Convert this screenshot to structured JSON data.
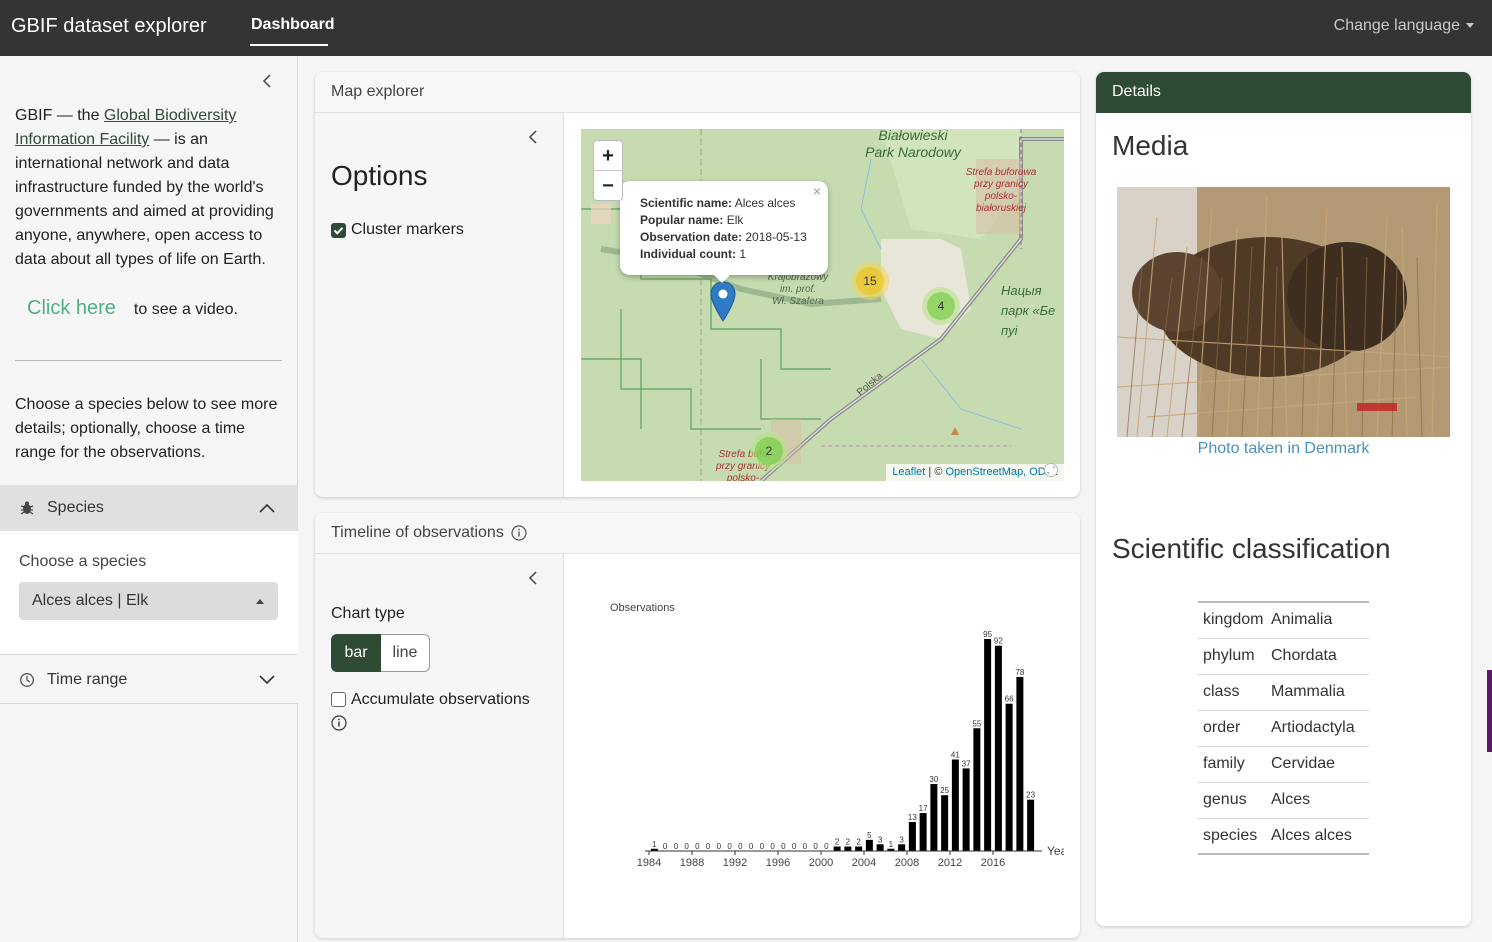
{
  "navbar": {
    "brand": "GBIF dataset explorer",
    "tab": "Dashboard",
    "language": "Change language"
  },
  "sidebar": {
    "intro_prefix": "GBIF — the ",
    "intro_link": "Global Biodiversity Information Facility",
    "intro_suffix": " — is an international network and data infrastructure funded by the world's governments and aimed at providing anyone, anywhere, open access to data about all types of life on Earth.",
    "video_link": "Click here",
    "video_text": "to see a video.",
    "instructions": "Choose a species below to see more details; optionally, choose a time range for the observations.",
    "species_section": "Species",
    "species_label": "Choose a species",
    "species_value": "Alces alces | Elk",
    "time_section": "Time range"
  },
  "map_card": {
    "title": "Map explorer",
    "options_title": "Options",
    "cluster_label": "Cluster markers",
    "popup": {
      "sci_label": "Scientific name:",
      "sci_value": "Alces alces",
      "pop_label": "Popular name:",
      "pop_value": "Elk",
      "date_label": "Observation date:",
      "date_value": "2018-05-13",
      "count_label": "Individual count:",
      "count_value": "1",
      "close": "×"
    },
    "clusters": [
      "15",
      "4",
      "2"
    ],
    "zoom_in": "+",
    "zoom_out": "−",
    "attribution_leaflet": "Leaflet",
    "attribution_sep": " | © ",
    "attribution_osm": "OpenStreetMap",
    "attribution_odbl": ", ODbL",
    "map_labels": {
      "park": "Białowieski\nPark Narodowy",
      "strefa_top": "Strefa buforowa\nprzy granicy\npolsko-\nbiałoruskiej",
      "krajobrazowy": "Krajobrazowy\nim. prof.\nWł. Szafera",
      "natsya": "Нацыя\nпарк «Бе\nпуі",
      "polska": "Polska",
      "strefa_bottom": "Strefa bufo\nprzy granicy\npolsko-"
    }
  },
  "timeline_card": {
    "title": "Timeline of observations",
    "chart_type_label": "Chart type",
    "btn_bar": "bar",
    "btn_line": "line",
    "accumulate_label": "Accumulate observations"
  },
  "chart_data": {
    "type": "bar",
    "ylabel": "Observations",
    "xlabel": "Year",
    "x": [
      1984,
      1985,
      1986,
      1987,
      1988,
      1989,
      1990,
      1991,
      1992,
      1993,
      1994,
      1995,
      1996,
      1997,
      1998,
      1999,
      2000,
      2001,
      2002,
      2003,
      2004,
      2005,
      2006,
      2007,
      2008,
      2009,
      2010,
      2011,
      2012,
      2013,
      2014,
      2015,
      2016,
      2017,
      2018
    ],
    "values": [
      1,
      0,
      0,
      0,
      0,
      0,
      0,
      0,
      0,
      0,
      0,
      0,
      0,
      0,
      0,
      0,
      0,
      2,
      2,
      2,
      5,
      3,
      1,
      3,
      13,
      17,
      30,
      25,
      41,
      37,
      55,
      95,
      92,
      66,
      78,
      23
    ],
    "xticks": [
      1984,
      1988,
      1992,
      1996,
      2000,
      2004,
      2008,
      2012,
      2016
    ],
    "grid": false
  },
  "details": {
    "title": "Details",
    "media_title": "Media",
    "photo_caption": "Photo taken in Denmark",
    "sci_title": "Scientific classification",
    "taxonomy": [
      {
        "rank": "kingdom",
        "value": "Animalia"
      },
      {
        "rank": "phylum",
        "value": "Chordata"
      },
      {
        "rank": "class",
        "value": "Mammalia"
      },
      {
        "rank": "order",
        "value": "Artiodactyla"
      },
      {
        "rank": "family",
        "value": "Cervidae"
      },
      {
        "rank": "genus",
        "value": "Alces"
      },
      {
        "rank": "species",
        "value": "Alces alces"
      }
    ]
  },
  "colors": {
    "brand_green": "#2f4a35",
    "navbar": "#343434",
    "link_green": "#4fb182",
    "cluster_yellow": "#f1d357",
    "cluster_green": "#6ecc39"
  },
  "icons": {
    "species": "bug-icon",
    "time": "clock-icon",
    "info": "info-icon",
    "marker": "map-marker-icon"
  }
}
